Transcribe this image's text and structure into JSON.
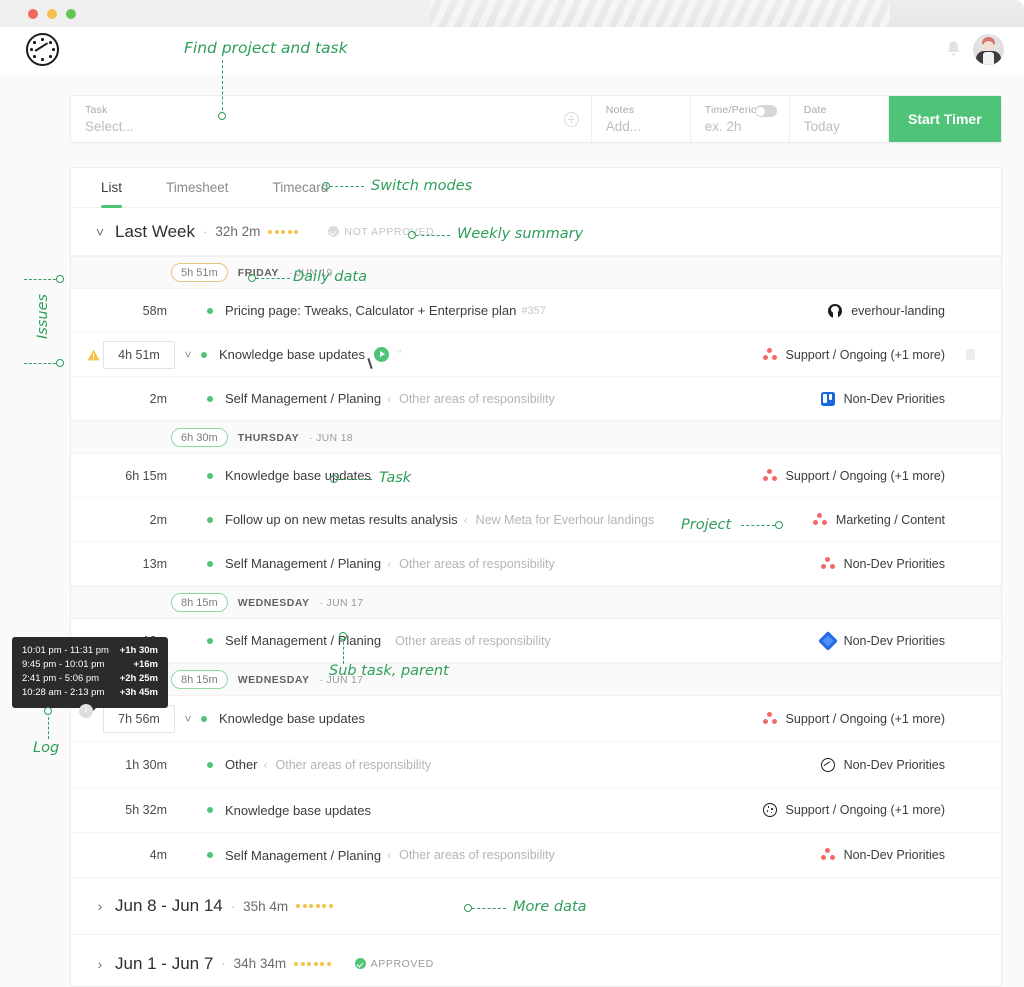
{
  "window": {
    "traffic_lights": [
      "close",
      "minimize",
      "zoom"
    ]
  },
  "appbar": {
    "logo_name": "everhour-logo",
    "bell_icon": "bell-icon",
    "avatar": "user-avatar"
  },
  "timer_bar": {
    "task": {
      "label": "Task",
      "placeholder": "Select...",
      "add_icon": "plus-circle-icon"
    },
    "notes": {
      "label": "Notes",
      "placeholder": "Add..."
    },
    "period": {
      "label": "Time/Period",
      "placeholder": "ex. 2h",
      "toggle": "off"
    },
    "date": {
      "label": "Date",
      "placeholder": "Today"
    },
    "start_button": "Start Timer",
    "accent_color": "#4fc377"
  },
  "tabs": [
    {
      "label": "List",
      "active": true
    },
    {
      "label": "Timesheet",
      "active": false
    },
    {
      "label": "Timecard",
      "active": false
    }
  ],
  "weeks": [
    {
      "title": "Last Week",
      "sep": "·",
      "total": "32h 2m",
      "approval": "NOT APPROVED",
      "approved": false,
      "expanded": true
    },
    {
      "title": "Jun 8 - Jun 14",
      "sep": "·",
      "total": "35h 4m",
      "approval": "",
      "approved": false,
      "expanded": false
    },
    {
      "title": "Jun 1 - Jun 7",
      "sep": "·",
      "total": "34h 34m",
      "approval": "APPROVED",
      "approved": true,
      "expanded": false
    }
  ],
  "days": [
    {
      "pill": "5h 51m",
      "pill_color": "amber",
      "name": "FRIDAY",
      "date": "JUN 19",
      "entries": [
        {
          "duration": "58m",
          "boxed": false,
          "warn": false,
          "chevron": false,
          "task": "Pricing page: Tweaks, Calculator + Enterprise plan",
          "id": "#357",
          "parent": "",
          "play": false,
          "quotes": false,
          "project": "everhour-landing",
          "icon": "github-icon",
          "trash": false
        },
        {
          "duration": "4h 51m",
          "boxed": true,
          "warn": true,
          "chevron": true,
          "task": "Knowledge base updates",
          "id": "",
          "parent": "",
          "play": true,
          "quotes": true,
          "project": "Support / Ongoing (+1 more)",
          "icon": "asana-icon",
          "trash": true
        },
        {
          "duration": "2m",
          "boxed": false,
          "warn": false,
          "chevron": false,
          "task": "Self Management / Planing",
          "id": "",
          "parent": "Other areas of responsibility",
          "play": false,
          "quotes": false,
          "project": "Non-Dev Priorities",
          "icon": "trello-icon",
          "trash": false
        }
      ]
    },
    {
      "pill": "6h 30m",
      "pill_color": "green",
      "name": "THURSDAY",
      "date": "JUN 18",
      "entries": [
        {
          "duration": "6h 15m",
          "boxed": false,
          "warn": false,
          "chevron": false,
          "task": "Knowledge base updates",
          "id": "",
          "parent": "",
          "play": false,
          "quotes": false,
          "project": "Support / Ongoing (+1 more)",
          "icon": "asana-icon",
          "trash": false
        },
        {
          "duration": "2m",
          "boxed": false,
          "warn": false,
          "chevron": false,
          "task": "Follow up on new metas results analysis",
          "id": "",
          "parent": "New Meta for Everhour landings",
          "play": false,
          "quotes": false,
          "project": "Marketing / Content",
          "icon": "asana-icon",
          "trash": false
        },
        {
          "duration": "13m",
          "boxed": false,
          "warn": false,
          "chevron": false,
          "task": "Self Management / Planing",
          "id": "",
          "parent": "Other areas of responsibility",
          "play": false,
          "quotes": false,
          "project": "Non-Dev Priorities",
          "icon": "asana-icon",
          "trash": false
        }
      ]
    },
    {
      "pill": "8h 15m",
      "pill_color": "green",
      "name": "WEDNESDAY",
      "date": "JUN 17",
      "entries": [
        {
          "duration": "13m",
          "boxed": false,
          "warn": false,
          "chevron": false,
          "task": "Self Management / Planing",
          "id": "",
          "parent": "Other areas of responsibility",
          "play": false,
          "quotes": false,
          "project": "Non-Dev Priorities",
          "icon": "jira-icon",
          "trash": false
        }
      ]
    },
    {
      "pill": "8h 15m",
      "pill_color": "green",
      "name": "WEDNESDAY",
      "date": "JUN 17",
      "entries": [
        {
          "duration": "7h 56m",
          "boxed": true,
          "warn": false,
          "chevron": true,
          "task": "Knowledge base updates",
          "id": "",
          "parent": "",
          "play": false,
          "quotes": false,
          "project": "Support / Ongoing (+1 more)",
          "icon": "asana-icon",
          "trash": false
        },
        {
          "duration": "1h 30m",
          "boxed": false,
          "warn": false,
          "chevron": false,
          "task": "Other",
          "id": "",
          "parent": "Other areas of responsibility",
          "play": false,
          "quotes": false,
          "project": "Non-Dev Priorities",
          "icon": "everhour-icon",
          "trash": false
        },
        {
          "duration": "5h 32m",
          "boxed": false,
          "warn": false,
          "chevron": false,
          "task": "Knowledge base updates",
          "id": "",
          "parent": "",
          "play": false,
          "quotes": false,
          "project": "Support / Ongoing (+1 more)",
          "icon": "everhour-dots-icon",
          "trash": false
        },
        {
          "duration": "4m",
          "boxed": false,
          "warn": false,
          "chevron": false,
          "task": "Self Management / Planing",
          "id": "",
          "parent": "Other areas of responsibility",
          "play": false,
          "quotes": false,
          "project": "Non-Dev Priorities",
          "icon": "asana-icon",
          "trash": false
        }
      ]
    }
  ],
  "tooltip": {
    "rows": [
      {
        "range": "10:01 pm - 11:31 pm",
        "amount": "+1h 30m"
      },
      {
        "range": "9:45 pm - 10:01 pm",
        "amount": "+16m"
      },
      {
        "range": "2:41 pm - 5:06 pm",
        "amount": "+2h 25m"
      },
      {
        "range": "10:28 am - 2:13 pm",
        "amount": "+3h 45m"
      }
    ]
  },
  "annotations": {
    "find": "Find project and task",
    "switch_modes": "Switch modes",
    "weekly_summary": "Weekly summary",
    "daily_data": "Daily data",
    "issues": "Issues",
    "task": "Task",
    "project": "Project",
    "subtask": "Sub task, parent",
    "log": "Log",
    "more_data": "More data",
    "color": "#2e9e5b"
  }
}
